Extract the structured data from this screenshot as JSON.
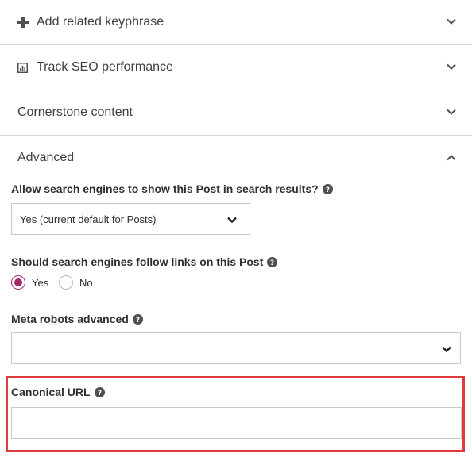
{
  "sections": [
    {
      "title": "Add related keyphrase",
      "icon": "plus-icon",
      "state": "collapsed"
    },
    {
      "title": "Track SEO performance",
      "icon": "chart-icon",
      "state": "collapsed"
    },
    {
      "title": "Cornerstone content",
      "icon": "",
      "state": "collapsed"
    }
  ],
  "advanced": {
    "title": "Advanced",
    "state": "expanded",
    "index_question": "Allow search engines to show this Post in search results?",
    "index_value": "Yes (current default for Posts)",
    "follow_question": "Should search engines follow links on this Post",
    "follow_options": [
      {
        "label": "Yes",
        "selected": true
      },
      {
        "label": "No",
        "selected": false
      }
    ],
    "meta_robots_label": "Meta robots advanced",
    "meta_robots_value": "",
    "canonical_label": "Canonical URL",
    "canonical_value": ""
  },
  "colors": {
    "accent": "#a4286a",
    "highlight": "#e03b3b",
    "border": "#c9c9c9",
    "divider": "#d9d9d9",
    "text": "#303030"
  }
}
